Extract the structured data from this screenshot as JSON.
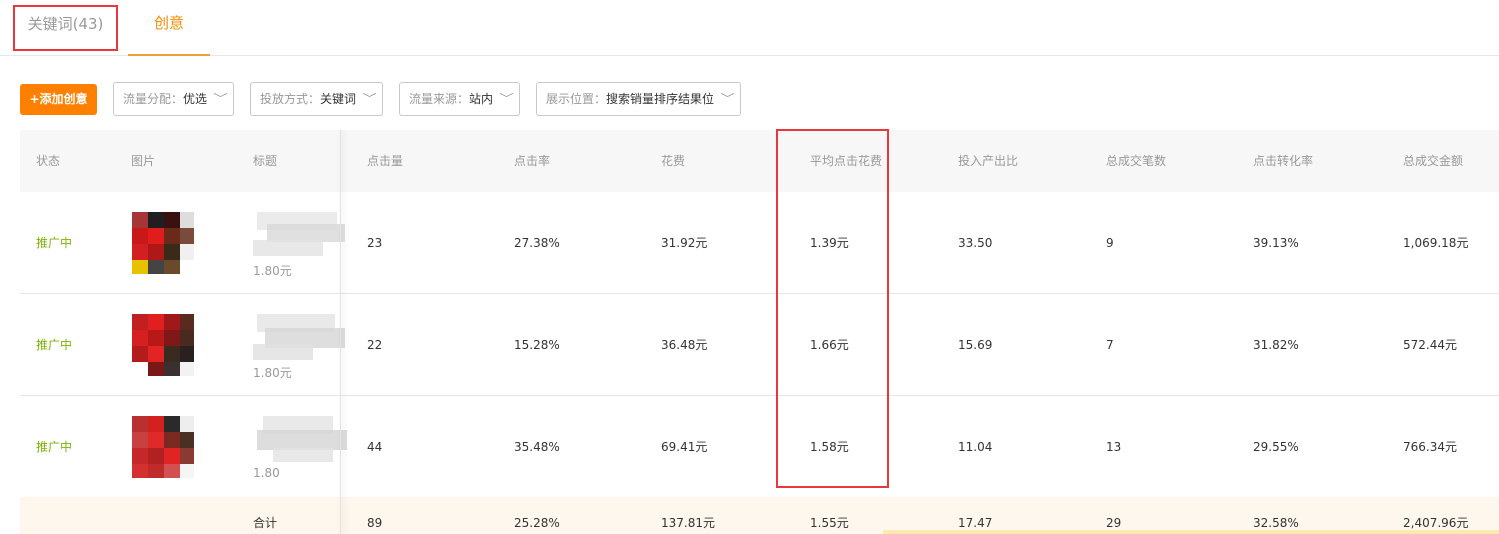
{
  "tabs": [
    {
      "label": "关键词(43)"
    },
    {
      "label": "创意"
    }
  ],
  "toolbar": {
    "add_label": "+添加创意",
    "filters": [
      {
        "key": "流量分配：",
        "value": "优选"
      },
      {
        "key": "投放方式：",
        "value": "关键词"
      },
      {
        "key": "流量来源：",
        "value": "站内"
      },
      {
        "key": "展示位置：",
        "value": "搜索销量排序结果位"
      }
    ]
  },
  "table": {
    "headers": [
      "状态",
      "图片",
      "标题",
      "点击量",
      "点击率",
      "花费",
      "平均点击花费",
      "投入产出比",
      "总成交笔数",
      "点击转化率",
      "总成交金额"
    ],
    "rows": [
      {
        "status": "推广中",
        "price": "1.80元",
        "clicks": "23",
        "ctr": "27.38%",
        "cost": "31.92元",
        "avg_cpc": "1.39元",
        "roi": "33.50",
        "orders": "9",
        "cvr": "39.13%",
        "gmv": "1,069.18元"
      },
      {
        "status": "推广中",
        "price": "1.80元",
        "clicks": "22",
        "ctr": "15.28%",
        "cost": "36.48元",
        "avg_cpc": "1.66元",
        "roi": "15.69",
        "orders": "7",
        "cvr": "31.82%",
        "gmv": "572.44元"
      },
      {
        "status": "推广中",
        "price": "1.80",
        "clicks": "44",
        "ctr": "35.48%",
        "cost": "69.41元",
        "avg_cpc": "1.58元",
        "roi": "11.04",
        "orders": "13",
        "cvr": "29.55%",
        "gmv": "766.34元"
      }
    ],
    "total": {
      "label": "合计",
      "clicks": "89",
      "ctr": "25.28%",
      "cost": "137.81元",
      "avg_cpc": "1.55元",
      "roi": "17.47",
      "orders": "29",
      "cvr": "32.58%",
      "gmv": "2,407.96元"
    }
  },
  "colors": {
    "accent": "#ff8000",
    "status": "#7cb305",
    "highlight": "#e8383d"
  },
  "icons": [
    "chevron-down-icon"
  ]
}
